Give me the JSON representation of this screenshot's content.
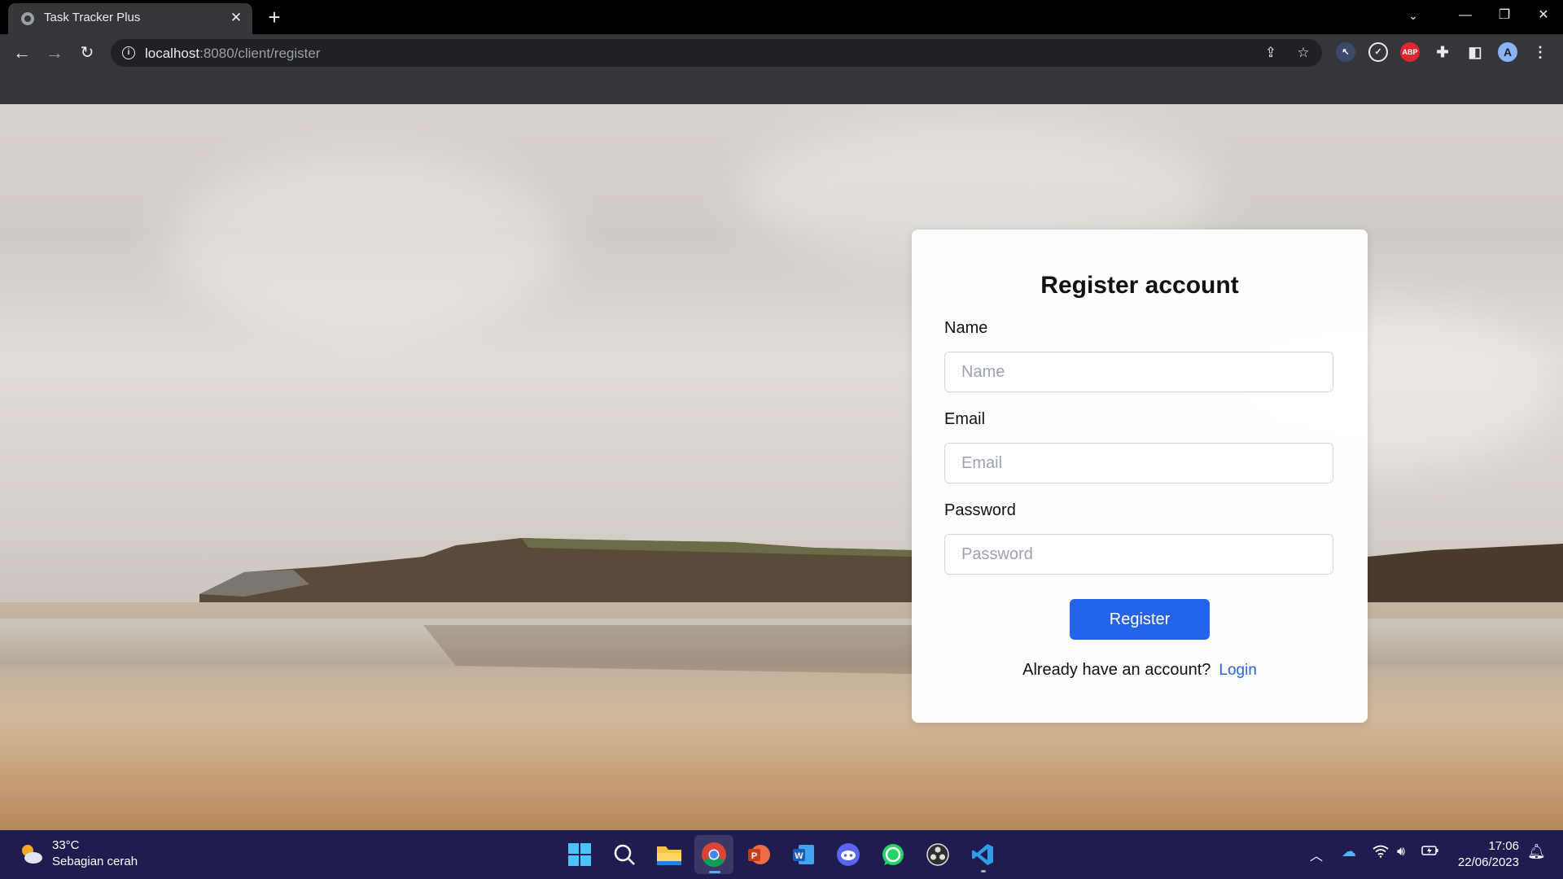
{
  "browser": {
    "tab_title": "Task Tracker Plus",
    "new_tab_symbol": "+",
    "url_host": "localhost",
    "url_rest": ":8080/client/register",
    "profile_initial": "A",
    "adblock_label": "ABP"
  },
  "form": {
    "title": "Register account",
    "name_label": "Name",
    "name_placeholder": "Name",
    "email_label": "Email",
    "email_placeholder": "Email",
    "password_label": "Password",
    "password_placeholder": "Password",
    "submit_label": "Register",
    "already_text": "Already have an account?",
    "login_link": "Login"
  },
  "taskbar": {
    "weather_temp": "33°C",
    "weather_desc": "Sebagian cerah",
    "time": "17:06",
    "date": "22/06/2023",
    "apps": [
      "start-icon",
      "search-icon",
      "file-explorer-icon",
      "chrome-icon",
      "powerpoint-icon",
      "word-icon",
      "discord-icon",
      "whatsapp-icon",
      "obs-icon",
      "vscode-icon"
    ]
  },
  "colors": {
    "accent": "#2563eb",
    "taskbar": "#1f1d4f",
    "chrome_toolbar": "#35363a"
  }
}
